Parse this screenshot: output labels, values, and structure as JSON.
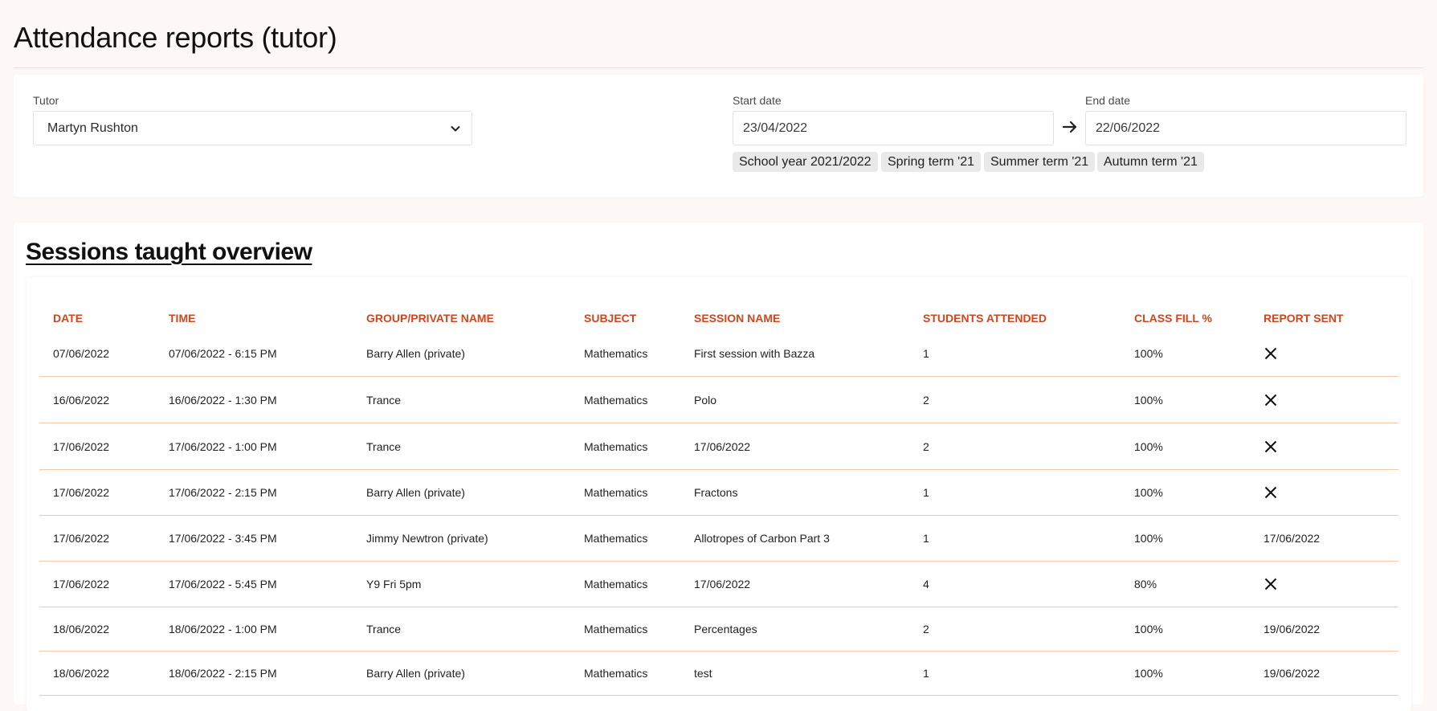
{
  "page": {
    "title": "Attendance reports (tutor)"
  },
  "filters": {
    "tutor_label": "Tutor",
    "tutor_value": "Martyn Rushton",
    "start_label": "Start date",
    "start_value": "23/04/2022",
    "end_label": "End date",
    "end_value": "22/06/2022",
    "chips": [
      "School year 2021/2022",
      "Spring term '21",
      "Summer term '21",
      "Autumn term '21"
    ]
  },
  "overview": {
    "title": "Sessions taught overview",
    "columns": [
      "DATE",
      "TIME",
      "GROUP/PRIVATE NAME",
      "SUBJECT",
      "SESSION NAME",
      "STUDENTS ATTENDED",
      "CLASS FILL %",
      "REPORT SENT"
    ],
    "rows": [
      {
        "date": "07/06/2022",
        "time": "07/06/2022 - 6:15 PM",
        "group": "Barry Allen (private)",
        "subject": "Mathematics",
        "session": "First session with Bazza",
        "students": "1",
        "fill": "100%",
        "report": ""
      },
      {
        "date": "16/06/2022",
        "time": "16/06/2022 - 1:30 PM",
        "group": "Trance",
        "subject": "Mathematics",
        "session": "Polo",
        "students": "2",
        "fill": "100%",
        "report": ""
      },
      {
        "date": "17/06/2022",
        "time": "17/06/2022 - 1:00 PM",
        "group": "Trance",
        "subject": "Mathematics",
        "session": "17/06/2022",
        "students": "2",
        "fill": "100%",
        "report": ""
      },
      {
        "date": "17/06/2022",
        "time": "17/06/2022 - 2:15 PM",
        "group": "Barry Allen (private)",
        "subject": "Mathematics",
        "session": "Fractons",
        "students": "1",
        "fill": "100%",
        "report": ""
      },
      {
        "date": "17/06/2022",
        "time": "17/06/2022 - 3:45 PM",
        "group": "Jimmy Newtron (private)",
        "subject": "Mathematics",
        "session": "Allotropes of Carbon Part 3",
        "students": "1",
        "fill": "100%",
        "report": "17/06/2022"
      },
      {
        "date": "17/06/2022",
        "time": "17/06/2022 - 5:45 PM",
        "group": "Y9 Fri 5pm",
        "subject": "Mathematics",
        "session": "17/06/2022",
        "students": "4",
        "fill": "80%",
        "report": ""
      },
      {
        "date": "18/06/2022",
        "time": "18/06/2022 - 1:00 PM",
        "group": "Trance",
        "subject": "Mathematics",
        "session": "Percentages",
        "students": "2",
        "fill": "100%",
        "report": "19/06/2022"
      },
      {
        "date": "18/06/2022",
        "time": "18/06/2022 - 2:15 PM",
        "group": "Barry Allen (private)",
        "subject": "Mathematics",
        "session": "test",
        "students": "1",
        "fill": "100%",
        "report": "19/06/2022"
      }
    ]
  },
  "icons": {
    "dropdown": "chevron-down-icon",
    "range": "arrow-right-icon",
    "not_sent": "close-icon"
  },
  "colors": {
    "accent": "#d0461e",
    "row_divider": "#f5c9a9",
    "background": "#fdf8f6"
  }
}
